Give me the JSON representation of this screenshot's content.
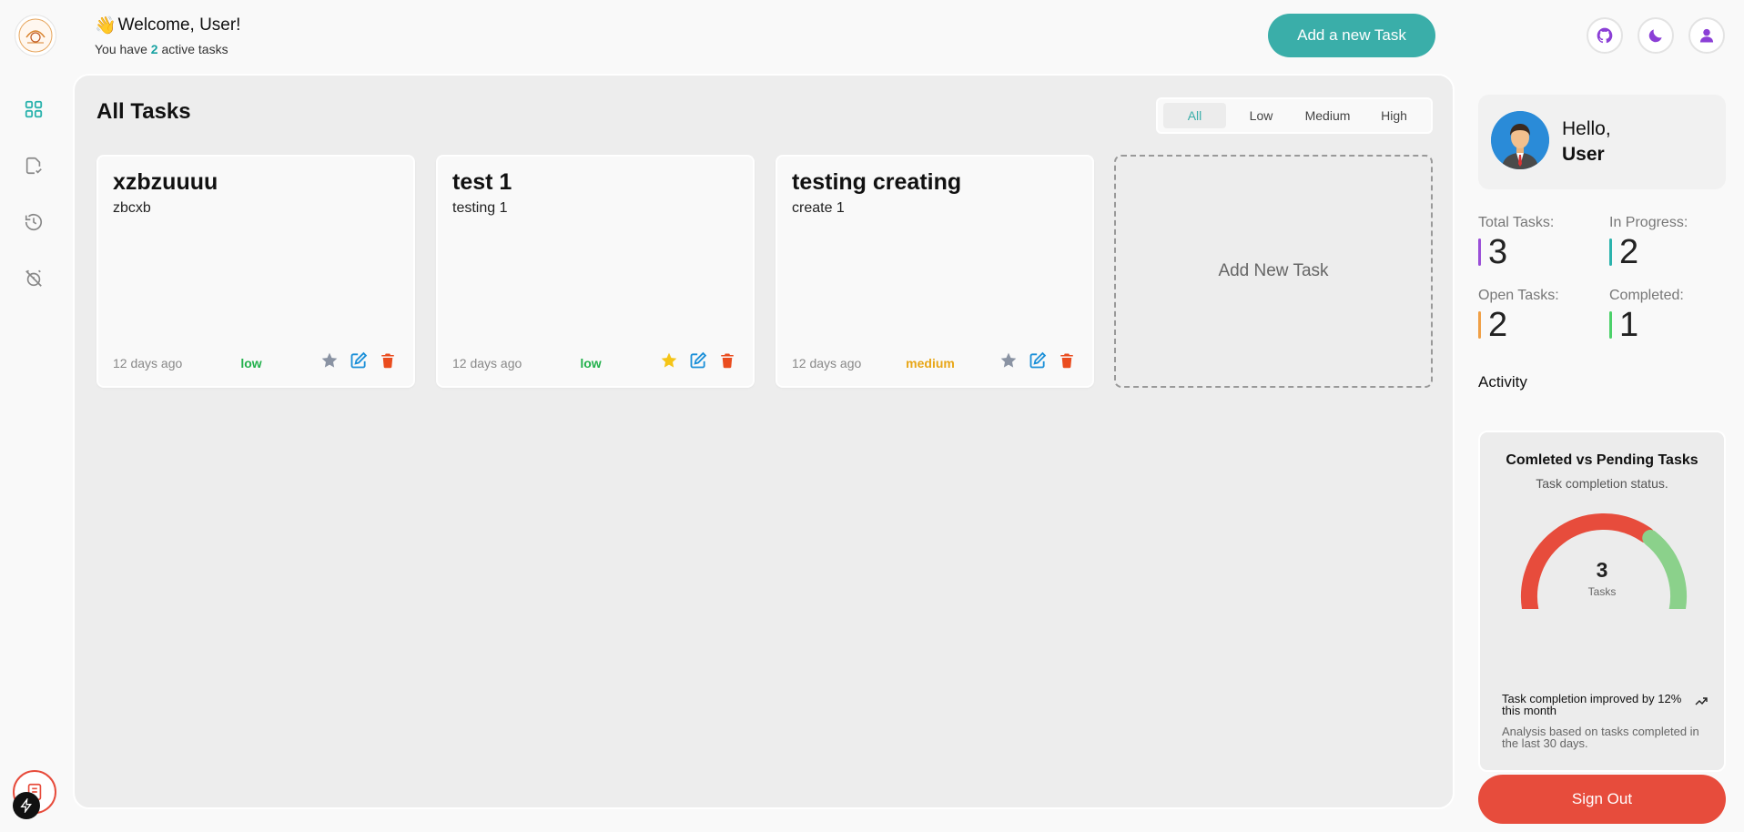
{
  "header": {
    "wave": "👋",
    "welcome_title": "Welcome, User!",
    "active_prefix": "You have ",
    "active_count": "2",
    "active_suffix": " active tasks",
    "add_task_label": "Add a new Task"
  },
  "top_icons": [
    "github-icon",
    "moon-icon",
    "user-icon"
  ],
  "nav": [
    "grid-icon",
    "file-check-icon",
    "clock-history-icon",
    "alarm-off-icon"
  ],
  "main": {
    "title": "All Tasks",
    "filters": [
      "All",
      "Low",
      "Medium",
      "High"
    ],
    "active_filter": "All",
    "tasks": [
      {
        "title": "xzbzuuuu",
        "desc": "zbcxb",
        "date": "12 days ago",
        "priority": "low",
        "starred": false
      },
      {
        "title": "test 1",
        "desc": "testing 1",
        "date": "12 days ago",
        "priority": "low",
        "starred": true
      },
      {
        "title": "testing creating",
        "desc": "create 1",
        "date": "12 days ago",
        "priority": "medium",
        "starred": false
      }
    ],
    "add_new_label": "Add New Task"
  },
  "colors": {
    "accent": "#3aaea9",
    "danger": "#e74c3c",
    "low": "#22b14c",
    "medium": "#e8a617",
    "star_on": "#f5c518",
    "star_off": "#8a93a3",
    "edit": "#1a8fd8"
  },
  "profile": {
    "hello": "Hello,",
    "name": "User"
  },
  "stats": {
    "total_label": "Total Tasks:",
    "total": "3",
    "progress_label": "In Progress:",
    "progress": "2",
    "open_label": "Open Tasks:",
    "open": "2",
    "completed_label": "Completed:",
    "completed": "1"
  },
  "activity_label": "Activity",
  "chart": {
    "title": "Comleted vs Pending Tasks",
    "subtitle": "Task completion status.",
    "center_value": "3",
    "center_label": "Tasks",
    "footer_main": "Task completion improved by 12% this month",
    "footer_sub": "Analysis based on tasks completed in the last 30 days."
  },
  "chart_data": {
    "type": "pie",
    "categories": [
      "Pending",
      "Completed"
    ],
    "values": [
      2,
      1
    ],
    "colors": [
      "#e74c3c",
      "#8bd18b"
    ]
  },
  "signout_label": "Sign Out"
}
